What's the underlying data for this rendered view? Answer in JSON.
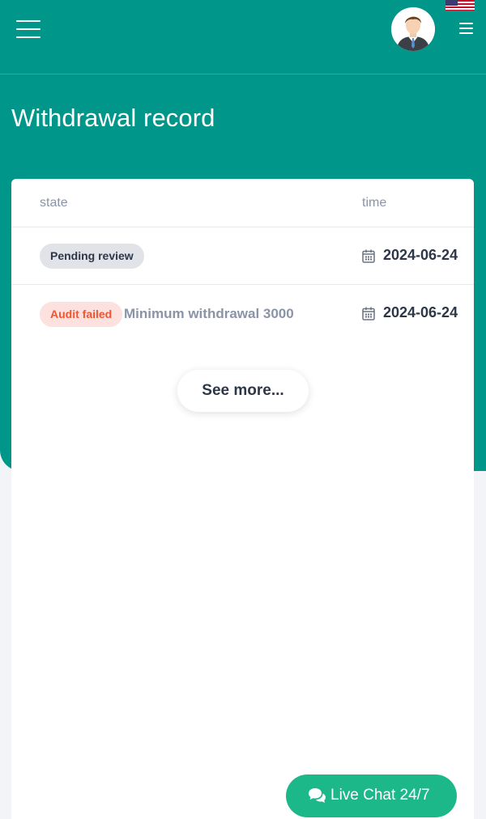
{
  "header": {
    "menu_icon": "hamburger-menu-icon",
    "avatar_icon": "user-avatar",
    "language_flag": "us-flag-icon",
    "secondary_menu_icon": "menu-icon"
  },
  "page": {
    "title": "Withdrawal record"
  },
  "table": {
    "columns": [
      "state",
      "time"
    ],
    "rows": [
      {
        "state": "Pending review",
        "note": "",
        "date": "2024-06-24"
      },
      {
        "state": "Audit failed",
        "note": "Minimum withdrawal 3000",
        "date": "2024-06-24"
      }
    ]
  },
  "actions": {
    "see_more": "See more..."
  },
  "live_chat": {
    "label": "Live Chat 24/7",
    "icon": "chat-bubbles-icon"
  },
  "colors": {
    "header_bg": "#00978a",
    "live_chat_bg": "#1db88a",
    "pending_badge_bg": "#e1e3e8",
    "failed_badge_bg": "#fde1de",
    "failed_badge_text": "#f0552f"
  }
}
